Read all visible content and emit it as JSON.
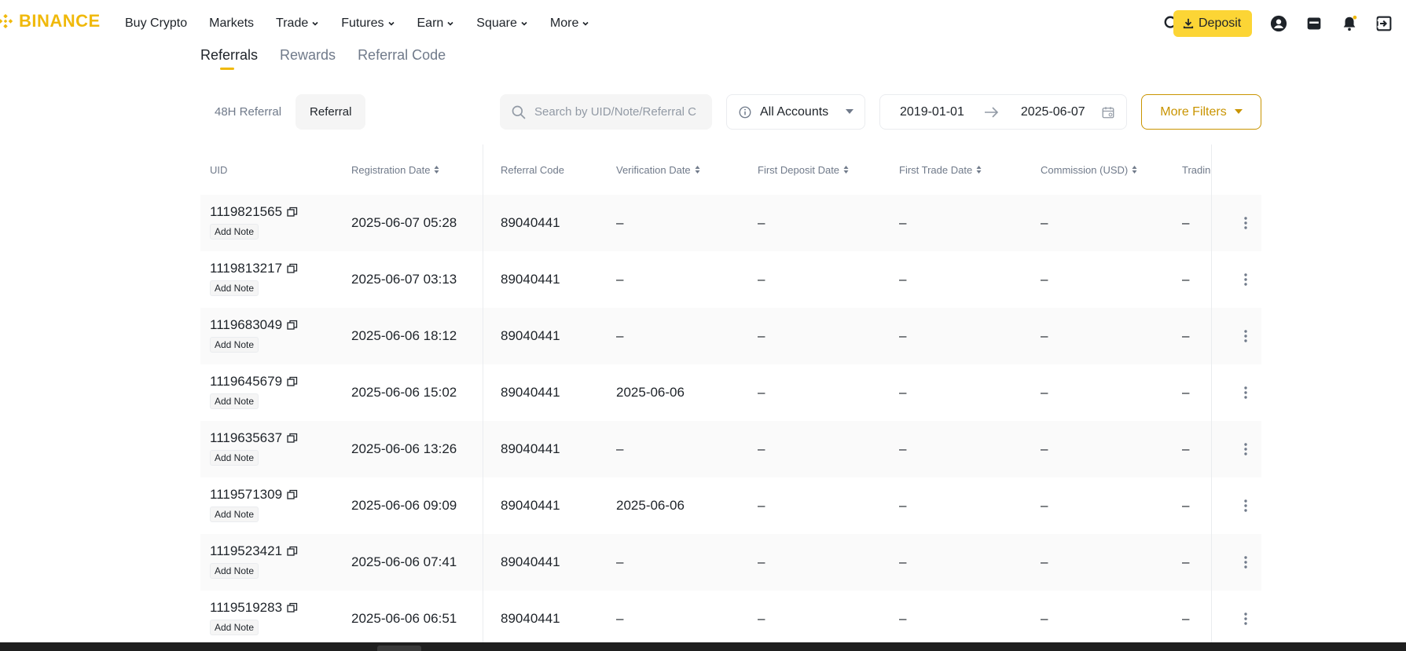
{
  "brand": {
    "name": "BINANCE",
    "color": "#f0b90b"
  },
  "nav": {
    "items": [
      {
        "label": "Buy Crypto",
        "dropdown": false
      },
      {
        "label": "Markets",
        "dropdown": false
      },
      {
        "label": "Trade",
        "dropdown": true
      },
      {
        "label": "Futures",
        "dropdown": true
      },
      {
        "label": "Earn",
        "dropdown": true
      },
      {
        "label": "Square",
        "dropdown": true
      },
      {
        "label": "More",
        "dropdown": true
      }
    ],
    "deposit_label": "Deposit",
    "icons": [
      "search-icon",
      "download-icon",
      "user-icon",
      "wallet-icon",
      "bell-icon",
      "download-app-icon"
    ]
  },
  "subtabs": [
    "Referrals",
    "Rewards",
    "Referral Code"
  ],
  "filters": {
    "segments": [
      "48H Referral",
      "Referral"
    ],
    "search_placeholder": "Search by UID/Note/Referral C",
    "accounts": "All Accounts",
    "date_from": "2019-01-01",
    "date_to": "2025-06-07",
    "more_filters": "More Filters"
  },
  "table": {
    "columns": [
      "UID",
      "Registration Date",
      "Referral Code",
      "Verification Date",
      "First Deposit Date",
      "First Trade Date",
      "Commission (USD)",
      "Trading"
    ],
    "add_note": "Add Note",
    "rows": [
      {
        "uid": "1119821565",
        "reg": "2025-06-07 05:28",
        "code": "89040441",
        "ver": "–",
        "dep": "–",
        "trade": "–",
        "comm": "–",
        "trading": "–"
      },
      {
        "uid": "1119813217",
        "reg": "2025-06-07 03:13",
        "code": "89040441",
        "ver": "–",
        "dep": "–",
        "trade": "–",
        "comm": "–",
        "trading": "–"
      },
      {
        "uid": "1119683049",
        "reg": "2025-06-06 18:12",
        "code": "89040441",
        "ver": "–",
        "dep": "–",
        "trade": "–",
        "comm": "–",
        "trading": "–"
      },
      {
        "uid": "1119645679",
        "reg": "2025-06-06 15:02",
        "code": "89040441",
        "ver": "2025-06-06",
        "dep": "–",
        "trade": "–",
        "comm": "–",
        "trading": "–"
      },
      {
        "uid": "1119635637",
        "reg": "2025-06-06 13:26",
        "code": "89040441",
        "ver": "–",
        "dep": "–",
        "trade": "–",
        "comm": "–",
        "trading": "–"
      },
      {
        "uid": "1119571309",
        "reg": "2025-06-06 09:09",
        "code": "89040441",
        "ver": "2025-06-06",
        "dep": "–",
        "trade": "–",
        "comm": "–",
        "trading": "–"
      },
      {
        "uid": "1119523421",
        "reg": "2025-06-06 07:41",
        "code": "89040441",
        "ver": "–",
        "dep": "–",
        "trade": "–",
        "comm": "–",
        "trading": "–"
      },
      {
        "uid": "1119519283",
        "reg": "2025-06-06 06:51",
        "code": "89040441",
        "ver": "–",
        "dep": "–",
        "trade": "–",
        "comm": "–",
        "trading": "–"
      }
    ]
  }
}
